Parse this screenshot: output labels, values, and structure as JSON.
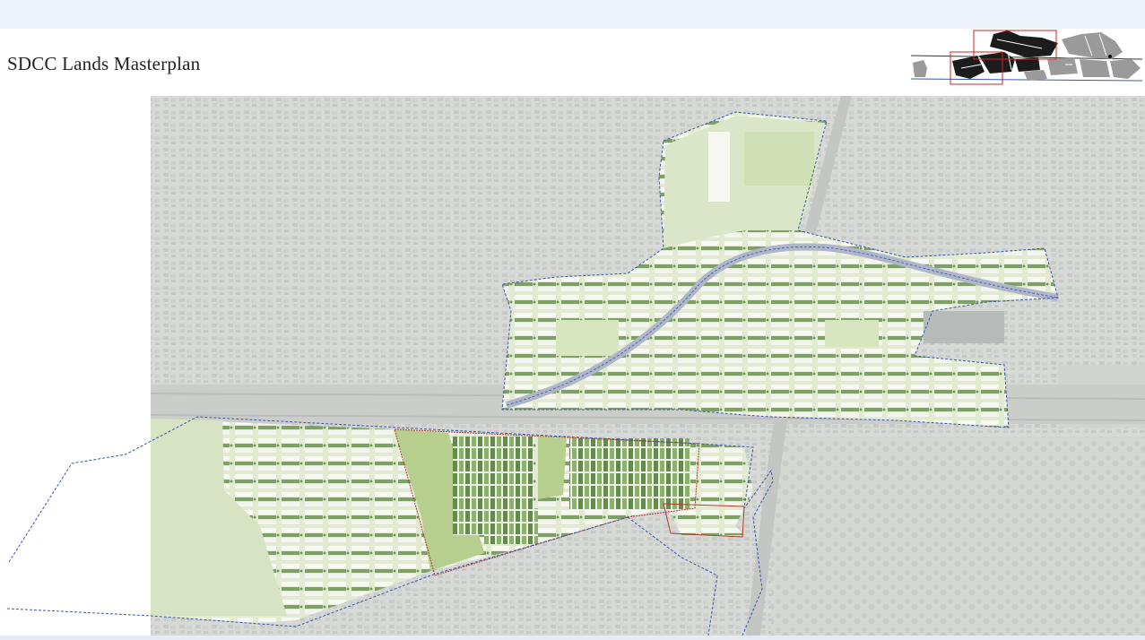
{
  "page": {
    "title": "SDCC Lands Masterplan"
  },
  "colors": {
    "background_band": "#edf1f8",
    "slide": "#ffffff",
    "aerial_base": "#d9dcd9",
    "plan_fill": "#e4ecd2",
    "green_space": "#c8dca8",
    "road": "#c8cac8",
    "boundary_line": "#3a56a8",
    "site_boundary": "#b23a2a",
    "keyplan_dark": "#1c1c1c",
    "keyplan_grey": "#9a9a9a",
    "keyplan_highlight": "#d42020"
  },
  "icons": {
    "keyplan": "site-keyplan-icon"
  }
}
